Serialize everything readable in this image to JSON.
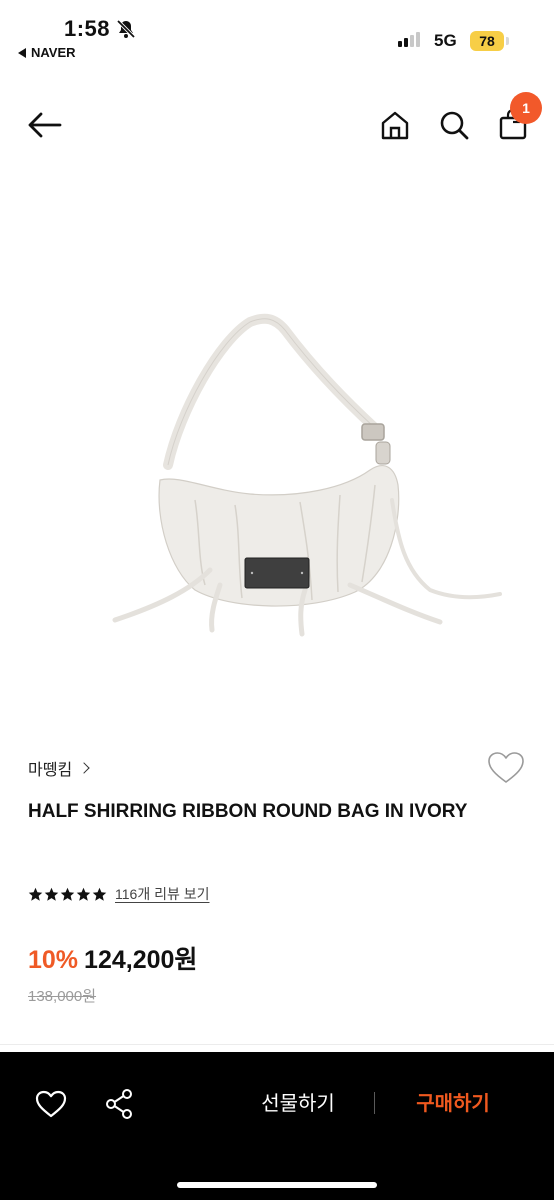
{
  "status_bar": {
    "time": "1:58",
    "back_app": "NAVER",
    "network": "5G",
    "battery": "78"
  },
  "header": {
    "cart_count": "1"
  },
  "product": {
    "brand": "마뗑킴",
    "title": "HALF SHIRRING RIBBON ROUND BAG IN IVORY",
    "rating_stars": 5,
    "review_link": "116개 리뷰 보기",
    "discount": "10%",
    "price": "124,200원",
    "original_price": "138,000원"
  },
  "bottom_bar": {
    "gift_label": "선물하기",
    "buy_label": "구매하기"
  },
  "colors": {
    "accent": "#ef5a26",
    "badge": "#f2592a",
    "battery": "#f7ce46"
  },
  "icons": [
    "back-arrow-icon",
    "home-icon",
    "search-icon",
    "cart-icon",
    "heart-icon",
    "share-icon",
    "star-icon",
    "bell-slash-icon"
  ]
}
